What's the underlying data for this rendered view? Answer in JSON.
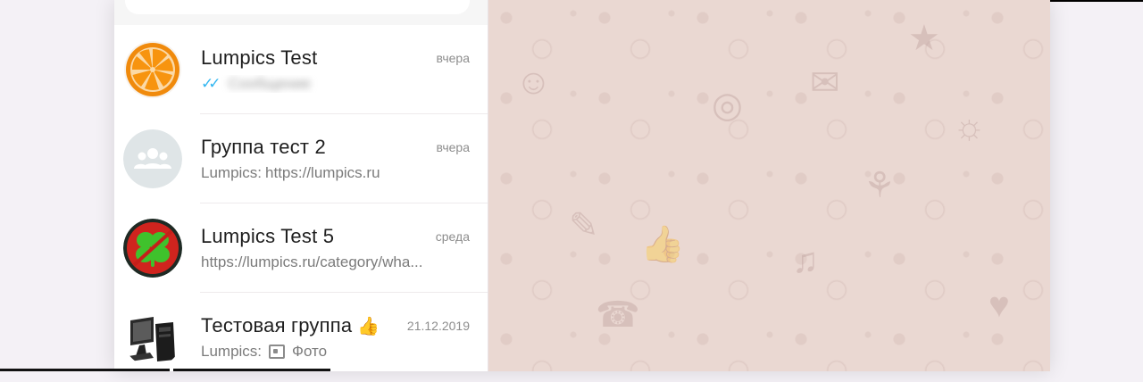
{
  "chats": [
    {
      "name": "Lumpics Test",
      "time": "вчера",
      "preview": "Сообщение",
      "status": "read"
    },
    {
      "name": "Группа тест 2",
      "time": "вчера",
      "sender": "Lumpics:",
      "preview": "https://lumpics.ru"
    },
    {
      "name": "Lumpics Test 5",
      "time": "среда",
      "preview": "https://lumpics.ru/category/wha..."
    },
    {
      "name": "Тестовая группа",
      "emoji": "👍",
      "time": "21.12.2019",
      "sender": "Lumpics:",
      "preview": "Фото"
    }
  ],
  "colors": {
    "read_ticks": "#34b7f1",
    "wallpaper": "#ead8d2"
  },
  "icons": [
    "orange-avatar-icon",
    "group-avatar-icon",
    "clover-avatar-icon",
    "computer-avatar-icon",
    "double-check-icon",
    "photo-icon",
    "thumbs-up-icon"
  ]
}
